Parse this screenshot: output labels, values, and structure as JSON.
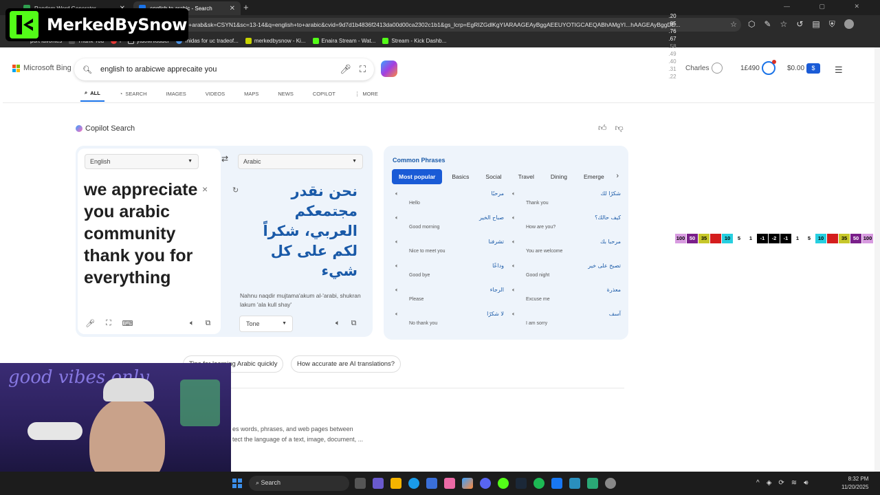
{
  "browser": {
    "tabs": [
      {
        "title": "Random Word Generator"
      },
      {
        "title": "english to arabic - Search"
      }
    ],
    "url": "s+to+arab&sk=CSYN1&sc=13-14&q=english+to+arabic&cvid=9d7d1b4836f2413da00d00ca2302c1b1&gs_lcrp=EgRIZGdlKgYIARAAGEAyBggAEEUYOTIGCAEQABhAMgYI...hAAGEAyBggDE...",
    "favorites": [
      "port favorites",
      "Thank You",
      "i",
      "ytdownloader",
      "midas for uc tradeof...",
      "merkedbysnow - Ki...",
      "Enaira Stream - Wat...",
      "Stream - Kick Dashb..."
    ]
  },
  "overlay": {
    "logo_text": "MerkedBySnow",
    "stats": [
      ".20",
      ".85",
      ".76",
      ".67",
      ".58",
      ".49",
      ".40",
      ".31",
      ".22"
    ],
    "numbers": [
      "100",
      "50",
      "35",
      "20",
      "10",
      "5",
      "1",
      "-1",
      "-2",
      "-1",
      "1",
      "5",
      "10",
      "20",
      "35",
      "50",
      "100"
    ]
  },
  "header": {
    "brand": "Microsoft Bing",
    "query": "english to arabicwe apprecaite you",
    "user": "Charles",
    "points": "1£490",
    "money": "$0.00"
  },
  "nav": {
    "tabs": [
      "ALL",
      "SEARCH",
      "IMAGES",
      "VIDEOS",
      "MAPS",
      "NEWS",
      "COPILOT",
      "MORE"
    ]
  },
  "copilot": {
    "title": "Copilot Search"
  },
  "translator": {
    "source_lang": "English",
    "target_lang": "Arabic",
    "source_text": "we appreciate you arabic community thank you for everything",
    "target_text": "نحن نقدر مجتمعكم العربي، شكراً لكم على كل شيء",
    "transliteration": "Nahnu naqdir mujtama'akum al-'arabi, shukran lakum 'ala kull shay'",
    "tone_label": "Tone"
  },
  "phrases": {
    "title": "Common Phrases",
    "tabs": [
      "Most popular",
      "Basics",
      "Social",
      "Travel",
      "Dining",
      "Emerge"
    ],
    "items": [
      {
        "ar": "مرحبًا",
        "en": "Hello"
      },
      {
        "ar": "شكرًا لك",
        "en": "Thank you"
      },
      {
        "ar": "صباح الخير",
        "en": "Good morning"
      },
      {
        "ar": "كيف حالك؟",
        "en": "How are you?"
      },
      {
        "ar": "تشرفنا",
        "en": "Nice to meet you"
      },
      {
        "ar": "مرحبا بك",
        "en": "You are welcome"
      },
      {
        "ar": "وداعًا",
        "en": "Good bye"
      },
      {
        "ar": "تصبح على خير",
        "en": "Good night"
      },
      {
        "ar": "الرجاء",
        "en": "Please"
      },
      {
        "ar": "معذرة",
        "en": "Excuse me"
      },
      {
        "ar": "لا شكرًا",
        "en": "No thank you"
      },
      {
        "ar": "آسف",
        "en": "I am sorry"
      }
    ]
  },
  "suggestions": {
    "pills": [
      "Tips for learning Arabic quickly",
      "How accurate are AI translations?"
    ]
  },
  "description": {
    "line1": "es words, phrases, and web pages between",
    "line2": "tect the language of a text, image, document, ..."
  },
  "webcam": {
    "text": "good vibes only"
  },
  "taskbar": {
    "search_label": "Search",
    "time": "8:32 PM",
    "date": "11/20/2025"
  }
}
